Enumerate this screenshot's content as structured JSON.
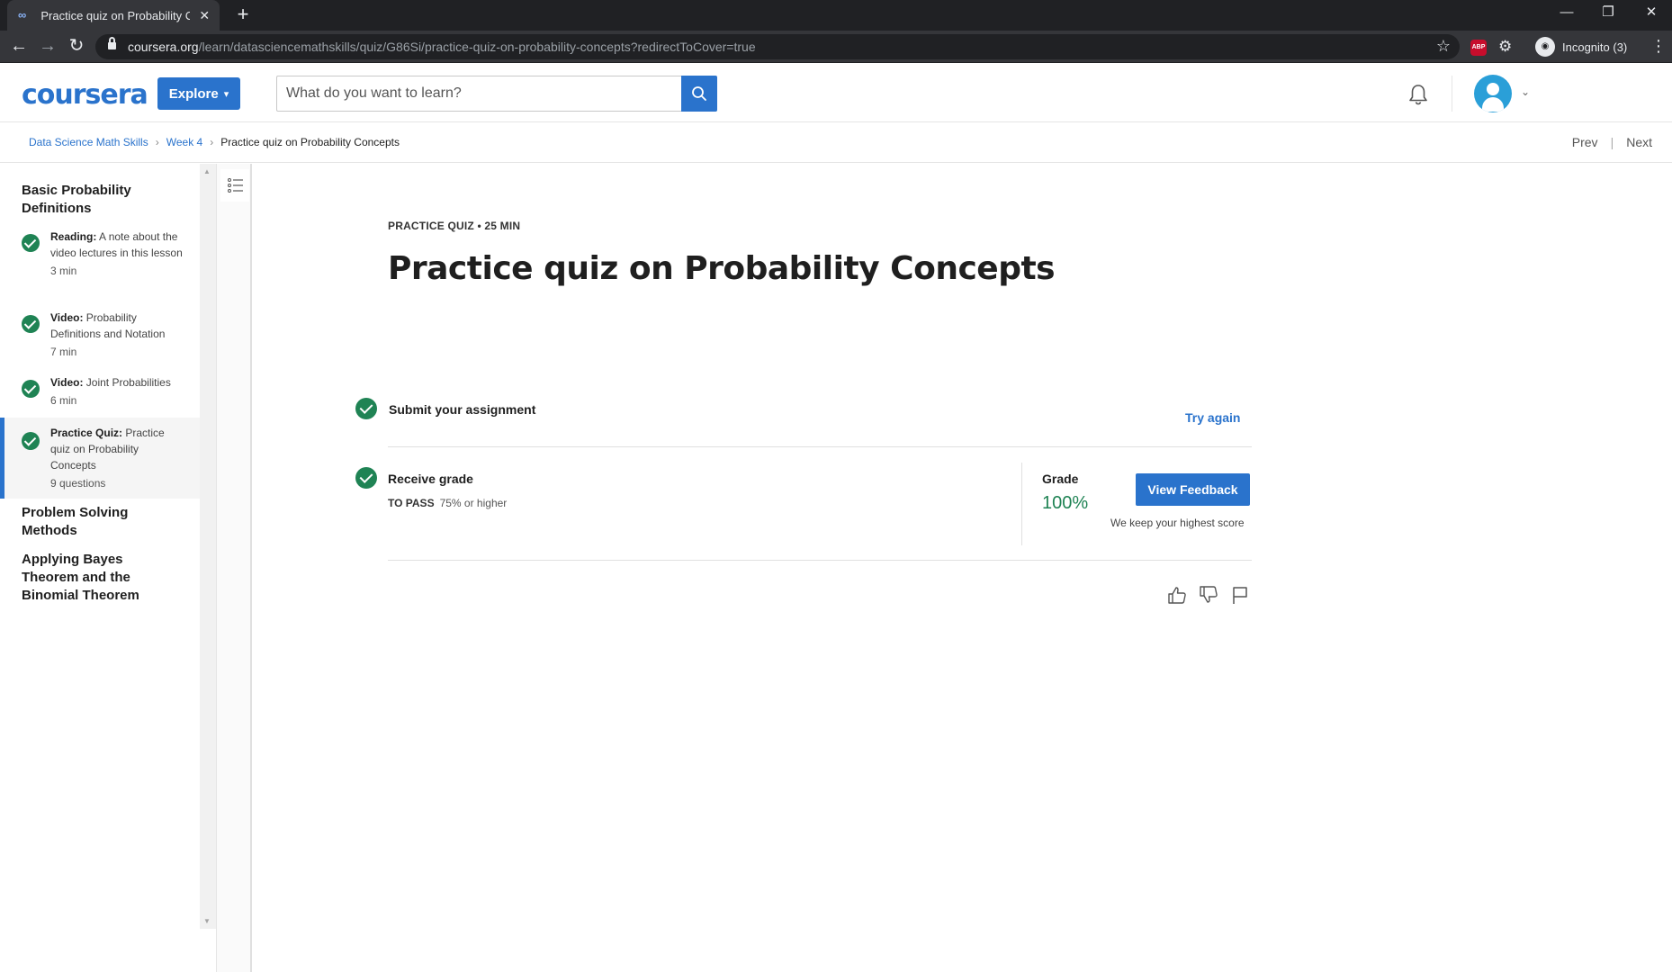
{
  "browser": {
    "tab_title": "Practice quiz on Probability Conc",
    "new_tab": "+",
    "close_tab": "✕",
    "url_host": "coursera.org",
    "url_path": "/learn/datasciencemathskills/quiz/G86Si/practice-quiz-on-probability-concepts?redirectToCover=true",
    "extension_abp": "ABP",
    "incognito_label": "Incognito (3)",
    "window_minimize": "—",
    "window_restore": "❐",
    "window_close": "✕"
  },
  "header": {
    "logo": "coursera",
    "explore_label": "Explore",
    "search_placeholder": "What do you want to learn?"
  },
  "breadcrumb": {
    "items": [
      "Data Science Math Skills",
      "Week 4"
    ],
    "current": "Practice quiz on Probability Concepts",
    "prev": "Prev",
    "next": "Next"
  },
  "sidebar": {
    "section_1_title": "Basic Probability Definitions",
    "items": [
      {
        "type": "Reading:",
        "title": "A note about the video lectures in this lesson",
        "meta": "3 min"
      },
      {
        "type": "Video:",
        "title": "Probability Definitions and Notation",
        "meta": "7 min"
      },
      {
        "type": "Video:",
        "title": "Joint Probabilities",
        "meta": "6 min"
      },
      {
        "type": "Practice Quiz:",
        "title": "Practice quiz on Probability Concepts",
        "meta": "9 questions"
      }
    ],
    "section_2_title": "Problem Solving Methods",
    "section_3_title": "Applying Bayes Theorem and the Binomial Theorem"
  },
  "main": {
    "eyebrow": "PRACTICE QUIZ • 25 MIN",
    "title": "Practice quiz on Probability Concepts",
    "submit_label": "Submit your assignment",
    "try_again": "Try again",
    "receive_label": "Receive grade",
    "to_pass_label": "TO PASS",
    "to_pass_value": "75% or higher",
    "grade_label": "Grade",
    "grade_value": "100%",
    "view_feedback": "View Feedback",
    "keep_score": "We keep your highest score"
  },
  "colors": {
    "brand_blue": "#2a73cc",
    "success_green": "#1f8354",
    "chrome_dark": "#202124"
  }
}
